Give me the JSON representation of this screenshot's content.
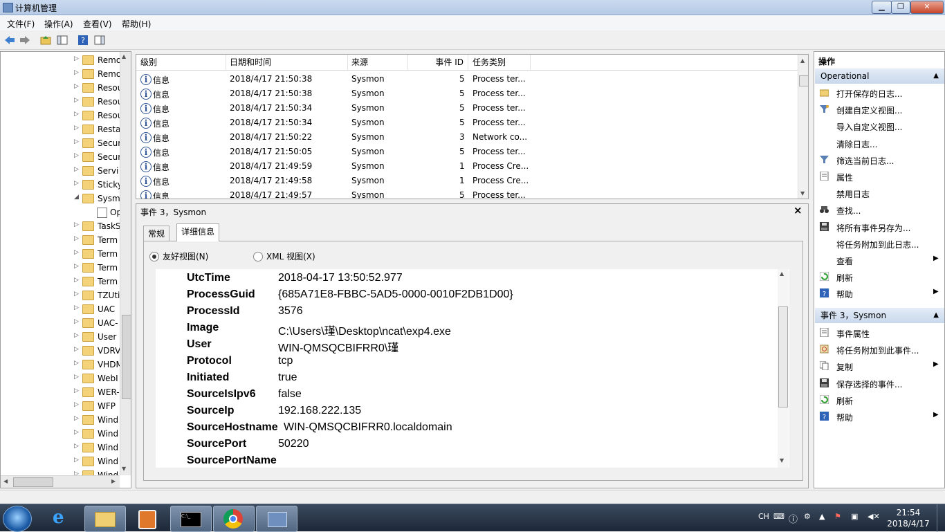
{
  "window": {
    "title": "计算机管理"
  },
  "menu": [
    "文件(F)",
    "操作(A)",
    "查看(V)",
    "帮助(H)"
  ],
  "tree": {
    "items": [
      {
        "label": "Remo",
        "expand": "▷"
      },
      {
        "label": "Remo",
        "expand": "▷"
      },
      {
        "label": "Resou",
        "expand": "▷"
      },
      {
        "label": "Resou",
        "expand": "▷"
      },
      {
        "label": "Resou",
        "expand": "▷"
      },
      {
        "label": "Resta",
        "expand": "▷"
      },
      {
        "label": "Secur",
        "expand": "▷"
      },
      {
        "label": "Secur",
        "expand": "▷"
      },
      {
        "label": "Servi",
        "expand": "▷"
      },
      {
        "label": "Sticky",
        "expand": "▷"
      },
      {
        "label": "Sysm",
        "expand": "◢"
      },
      {
        "label": "Op",
        "expand": ""
      },
      {
        "label": "TaskS",
        "expand": "▷"
      },
      {
        "label": "Term",
        "expand": "▷"
      },
      {
        "label": "Term",
        "expand": "▷"
      },
      {
        "label": "Term",
        "expand": "▷"
      },
      {
        "label": "Term",
        "expand": "▷"
      },
      {
        "label": "TZUti",
        "expand": "▷"
      },
      {
        "label": "UAC",
        "expand": "▷"
      },
      {
        "label": "UAC-",
        "expand": "▷"
      },
      {
        "label": "User",
        "expand": "▷"
      },
      {
        "label": "VDRV",
        "expand": "▷"
      },
      {
        "label": "VHDM",
        "expand": "▷"
      },
      {
        "label": "WebI",
        "expand": "▷"
      },
      {
        "label": "WER-",
        "expand": "▷"
      },
      {
        "label": "WFP",
        "expand": "▷"
      },
      {
        "label": "Wind",
        "expand": "▷"
      },
      {
        "label": "Wind",
        "expand": "▷"
      },
      {
        "label": "Wind",
        "expand": "▷"
      },
      {
        "label": "Wind",
        "expand": "▷"
      },
      {
        "label": "Wind",
        "expand": "▷"
      }
    ]
  },
  "events": {
    "columns": [
      "级别",
      "日期和时间",
      "来源",
      "事件 ID",
      "任务类别"
    ],
    "rows": [
      {
        "level": "信息",
        "datetime": "2018/4/17 21:50:38",
        "source": "Sysmon",
        "id": "5",
        "task": "Process ter..."
      },
      {
        "level": "信息",
        "datetime": "2018/4/17 21:50:38",
        "source": "Sysmon",
        "id": "5",
        "task": "Process ter..."
      },
      {
        "level": "信息",
        "datetime": "2018/4/17 21:50:34",
        "source": "Sysmon",
        "id": "5",
        "task": "Process ter..."
      },
      {
        "level": "信息",
        "datetime": "2018/4/17 21:50:34",
        "source": "Sysmon",
        "id": "5",
        "task": "Process ter..."
      },
      {
        "level": "信息",
        "datetime": "2018/4/17 21:50:22",
        "source": "Sysmon",
        "id": "3",
        "task": "Network co..."
      },
      {
        "level": "信息",
        "datetime": "2018/4/17 21:50:05",
        "source": "Sysmon",
        "id": "5",
        "task": "Process ter..."
      },
      {
        "level": "信息",
        "datetime": "2018/4/17 21:49:59",
        "source": "Sysmon",
        "id": "1",
        "task": "Process Cre..."
      },
      {
        "level": "信息",
        "datetime": "2018/4/17 21:49:58",
        "source": "Sysmon",
        "id": "1",
        "task": "Process Cre..."
      },
      {
        "level": "信息",
        "datetime": "2018/4/17 21:49:57",
        "source": "Sysmon",
        "id": "5",
        "task": "Process ter..."
      }
    ]
  },
  "detail": {
    "title": "事件 3，Sysmon",
    "close": "×",
    "tabs": [
      "常规",
      "详细信息"
    ],
    "view_friendly": "友好视图(N)",
    "view_xml": "XML 视图(X)",
    "fields": [
      {
        "key": "UtcTime",
        "value": "2018-04-17 13:50:52.977"
      },
      {
        "key": "ProcessGuid",
        "value": "{685A71E8-FBBC-5AD5-0000-0010F2DB1D00}"
      },
      {
        "key": "ProcessId",
        "value": "3576"
      },
      {
        "key": "Image",
        "value": "C:\\Users\\瑾\\Desktop\\ncat\\exp4.exe"
      },
      {
        "key": "User",
        "value": "WIN-QMSQCBIFRR0\\瑾"
      },
      {
        "key": "Protocol",
        "value": "tcp"
      },
      {
        "key": "Initiated",
        "value": "true"
      },
      {
        "key": "SourceIsIpv6",
        "value": "false"
      },
      {
        "key": "SourceIp",
        "value": "192.168.222.135"
      },
      {
        "key": "SourceHostname",
        "value": "WIN-QMSQCBIFRR0.localdomain"
      },
      {
        "key": "SourcePort",
        "value": "50220"
      },
      {
        "key": "SourcePortName",
        "value": ""
      }
    ]
  },
  "actions": {
    "header": "操作",
    "section1": "Operational",
    "items1": [
      {
        "label": "打开保存的日志...",
        "icon": "open-folder-icon",
        "submenu": false
      },
      {
        "label": "创建自定义视图...",
        "icon": "filter-create-icon",
        "submenu": false
      },
      {
        "label": "导入自定义视图...",
        "icon": "",
        "submenu": false
      },
      {
        "label": "清除日志...",
        "icon": "",
        "submenu": false
      },
      {
        "label": "筛选当前日志...",
        "icon": "filter-icon",
        "submenu": false
      },
      {
        "label": "属性",
        "icon": "properties-icon",
        "submenu": false
      },
      {
        "label": "禁用日志",
        "icon": "",
        "submenu": false
      },
      {
        "label": "查找...",
        "icon": "binoculars-icon",
        "submenu": false
      },
      {
        "label": "将所有事件另存为...",
        "icon": "save-icon",
        "submenu": false
      },
      {
        "label": "将任务附加到此日志...",
        "icon": "",
        "submenu": false
      },
      {
        "label": "查看",
        "icon": "",
        "submenu": true
      },
      {
        "label": "刷新",
        "icon": "refresh-icon",
        "submenu": false
      },
      {
        "label": "帮助",
        "icon": "help-icon",
        "submenu": true
      }
    ],
    "section2": "事件 3，Sysmon",
    "items2": [
      {
        "label": "事件属性",
        "icon": "event-properties-icon",
        "submenu": false
      },
      {
        "label": "将任务附加到此事件...",
        "icon": "task-icon",
        "submenu": false
      },
      {
        "label": "复制",
        "icon": "copy-icon",
        "submenu": true
      },
      {
        "label": "保存选择的事件...",
        "icon": "save-icon",
        "submenu": false
      },
      {
        "label": "刷新",
        "icon": "refresh-icon",
        "submenu": false
      },
      {
        "label": "帮助",
        "icon": "help-icon",
        "submenu": true
      }
    ]
  },
  "taskbar": {
    "clock_time": "21:54",
    "clock_date": "2018/4/17",
    "ime": "CH"
  }
}
